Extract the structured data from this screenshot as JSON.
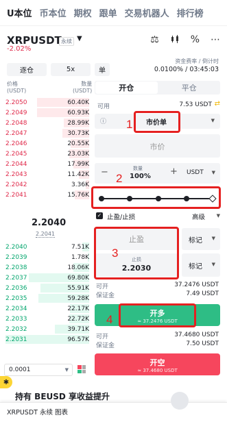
{
  "nav": {
    "tabs": [
      "U本位",
      "币本位",
      "期权",
      "跟单",
      "交易机器人",
      "排行榜"
    ],
    "active_index": 0
  },
  "symbol": {
    "name": "XRPUSDT",
    "type": "永续",
    "change": "-2.02%"
  },
  "funding": {
    "label": "资金费率 / 倒计时",
    "value": "0.0100% / 03:45:03"
  },
  "controls": {
    "margin_mode": "逐仓",
    "leverage": "5x",
    "mode": "单"
  },
  "book": {
    "price_header": "价格",
    "price_unit": "(USDT)",
    "qty_header": "数量",
    "qty_unit": "(USDT)",
    "asks": [
      {
        "p": "2.2050",
        "q": "60.40K",
        "w": 0.62
      },
      {
        "p": "2.2049",
        "q": "60.93K",
        "w": 0.62
      },
      {
        "p": "2.2048",
        "q": "28.99K",
        "w": 0.3
      },
      {
        "p": "2.2047",
        "q": "30.73K",
        "w": 0.32
      },
      {
        "p": "2.2046",
        "q": "20.55K",
        "w": 0.22
      },
      {
        "p": "2.2045",
        "q": "23.03K",
        "w": 0.24
      },
      {
        "p": "2.2044",
        "q": "17.99K",
        "w": 0.19
      },
      {
        "p": "2.2043",
        "q": "11.42K",
        "w": 0.12
      },
      {
        "p": "2.2042",
        "q": "3.36K",
        "w": 0.04
      },
      {
        "p": "2.2041",
        "q": "15.76K",
        "w": 0.17
      }
    ],
    "mid_price": "2.2040",
    "mark_price": "2.2041",
    "bids": [
      {
        "p": "2.2040",
        "q": "7.51K",
        "w": 0.08
      },
      {
        "p": "2.2039",
        "q": "1.78K",
        "w": 0.02
      },
      {
        "p": "2.2038",
        "q": "18.06K",
        "w": 0.19
      },
      {
        "p": "2.2037",
        "q": "69.80K",
        "w": 0.72
      },
      {
        "p": "2.2036",
        "q": "55.91K",
        "w": 0.58
      },
      {
        "p": "2.2035",
        "q": "59.28K",
        "w": 0.61
      },
      {
        "p": "2.2034",
        "q": "22.17K",
        "w": 0.23
      },
      {
        "p": "2.2033",
        "q": "22.72K",
        "w": 0.24
      },
      {
        "p": "2.2032",
        "q": "39.71K",
        "w": 0.41
      },
      {
        "p": "2.2031",
        "q": "96.57K",
        "w": 1.0
      }
    ],
    "precision": "0.0001"
  },
  "order": {
    "tabs": [
      "开仓",
      "平仓"
    ],
    "available_label": "可用",
    "available_value": "7.53 USDT",
    "order_type": "市价单",
    "price_placeholder": "市价",
    "qty_label": "数量",
    "qty_value": "100%",
    "qty_unit": "USDT",
    "tpsl_label": "止盈/止损",
    "advanced": "高级",
    "tp_placeholder": "止盈",
    "tp_mark": "标记",
    "sl_label": "止损",
    "sl_value": "2.2030",
    "sl_mark": "标记",
    "long_open_label": "可开",
    "long_open_value": "37.2476 USDT",
    "long_margin_label": "保证金",
    "long_margin_value": "7.49 USDT",
    "long_button": "开多",
    "long_button_sub": "≈ 37.2476 USDT",
    "short_open_label": "可开",
    "short_open_value": "37.4680 USDT",
    "short_margin_label": "保证金",
    "short_margin_value": "7.50 USDT",
    "short_button": "开空",
    "short_button_sub": "≈ 37.4680 USDT"
  },
  "annotations": [
    "1",
    "2",
    "3",
    "4"
  ],
  "bottom": {
    "holding_text": "持有 BEUSD  享收益提升",
    "footer": "XRPUSDT 永续  图表"
  },
  "colors": {
    "ask": "#e0294a",
    "bid": "#03a66d",
    "long": "#2ebd85",
    "short": "#f6465d",
    "annotation": "#e52020"
  }
}
